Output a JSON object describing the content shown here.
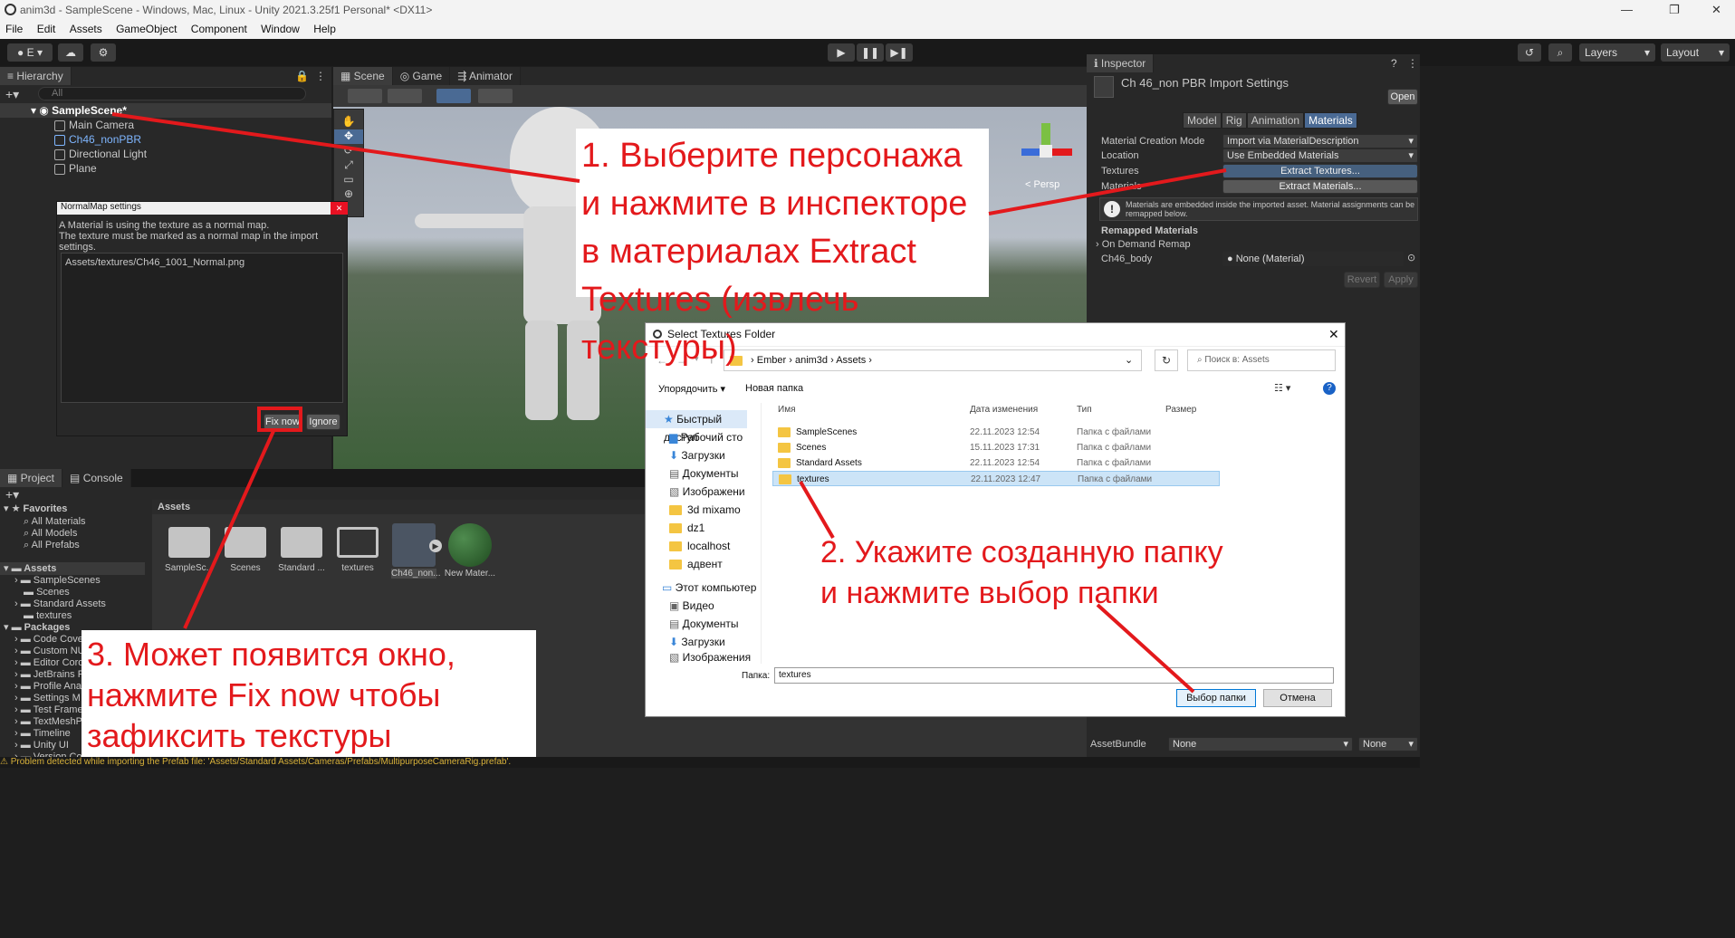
{
  "window": {
    "title": "anim3d - SampleScene - Windows, Mac, Linux - Unity 2021.3.25f1 Personal* <DX11>"
  },
  "menu": [
    "File",
    "Edit",
    "Assets",
    "GameObject",
    "Component",
    "Window",
    "Help"
  ],
  "toolbar": {
    "account_label": "E",
    "layers_label": "Layers",
    "layout_label": "Layout"
  },
  "hierarchy": {
    "tab": "Hierarchy",
    "search_placeholder": "All",
    "scene": "SampleScene*",
    "items": [
      "Main Camera",
      "Ch46_nonPBR",
      "Directional Light",
      "Plane"
    ]
  },
  "scene_view": {
    "tabs": [
      "Scene",
      "Game",
      "Animator"
    ],
    "mode_2d": "2D",
    "persp_label": "< Persp"
  },
  "normalmap_dialog": {
    "title": "NormalMap settings",
    "line1": "A Material is using the texture as a normal map.",
    "line2": "The texture must be marked as a normal map in the import settings.",
    "path": "Assets/textures/Ch46_1001_Normal.png",
    "fix_label": "Fix now",
    "ignore_label": "Ignore"
  },
  "inspector": {
    "tab": "Inspector",
    "title": "Ch 46_non PBR Import Settings",
    "open_label": "Open",
    "tabs": [
      "Model",
      "Rig",
      "Animation",
      "Materials"
    ],
    "fields": {
      "material_creation_mode": "Material Creation Mode",
      "material_creation_value": "Import via MaterialDescription",
      "location": "Location",
      "location_value": "Use Embedded Materials",
      "textures": "Textures",
      "extract_textures": "Extract Textures...",
      "materials": "Materials",
      "extract_materials": "Extract Materials..."
    },
    "info": "Materials are embedded inside the imported asset. Material assignments can be remapped below.",
    "remapped": "Remapped Materials",
    "on_demand": "On Demand Remap",
    "body_label": "Ch46_body",
    "body_value": "None (Material)",
    "revert": "Revert",
    "apply": "Apply",
    "assetbundle": "AssetBundle",
    "assetbundle_value": "None",
    "assetbundle_variant": "None"
  },
  "project": {
    "tabs": [
      "Project",
      "Console"
    ],
    "favorites": "Favorites",
    "fav_items": [
      "All Materials",
      "All Models",
      "All Prefabs"
    ],
    "assets_header": "Assets",
    "asset_folders": [
      "SampleScenes",
      "Scenes",
      "Standard Assets",
      "textures"
    ],
    "packages": "Packages",
    "package_items": [
      "Code Cove",
      "Custom NU",
      "Editor Coro",
      "JetBrains R",
      "Profile Ana",
      "Settings M",
      "Test Frame",
      "TextMeshP",
      "Timeline",
      "Unity UI",
      "Version Co"
    ],
    "grid_title": "Assets",
    "grid_items": [
      "SampleSc...",
      "Scenes",
      "Standard ...",
      "textures",
      "Ch46_non...",
      "New Mater..."
    ]
  },
  "status": {
    "warning": "Problem detected while importing the Prefab file: 'Assets/Standard Assets/Cameras/Prefabs/MultipurposeCameraRig.prefab'."
  },
  "folder_dialog": {
    "title": "Select Textures Folder",
    "crumbs": [
      "Ember",
      "anim3d",
      "Assets"
    ],
    "search_placeholder": "Поиск в: Assets",
    "organize": "Упорядочить",
    "new_folder": "Новая папка",
    "columns": [
      "Имя",
      "Дата изменения",
      "Тип",
      "Размер"
    ],
    "nav": [
      "Быстрый доступ",
      "Рабочий сто",
      "Загрузки",
      "Документы",
      "Изображени",
      "3d mixamo",
      "dz1",
      "localhost",
      "адвент",
      "Этот компьютер",
      "Видео",
      "Документы",
      "Загрузки",
      "Изображения"
    ],
    "files": [
      {
        "name": "SampleScenes",
        "date": "22.11.2023 12:54",
        "type": "Папка с файлами"
      },
      {
        "name": "Scenes",
        "date": "15.11.2023 17:31",
        "type": "Папка с файлами"
      },
      {
        "name": "Standard Assets",
        "date": "22.11.2023 12:54",
        "type": "Папка с файлами"
      },
      {
        "name": "textures",
        "date": "22.11.2023 12:47",
        "type": "Папка с файлами"
      }
    ],
    "folder_label": "Папка:",
    "folder_value": "textures",
    "select_label": "Выбор папки",
    "cancel_label": "Отмена"
  },
  "annotations": {
    "step1": "1. Выберите персонажа и нажмите в инспекторе в материалах Extract Textures (извлечь текстуры)",
    "step2": "2. Укажите созданную папку и нажмите выбор папки",
    "step3": "3. Может появится окно, нажмите Fix now чтобы зафиксить текстуры"
  }
}
